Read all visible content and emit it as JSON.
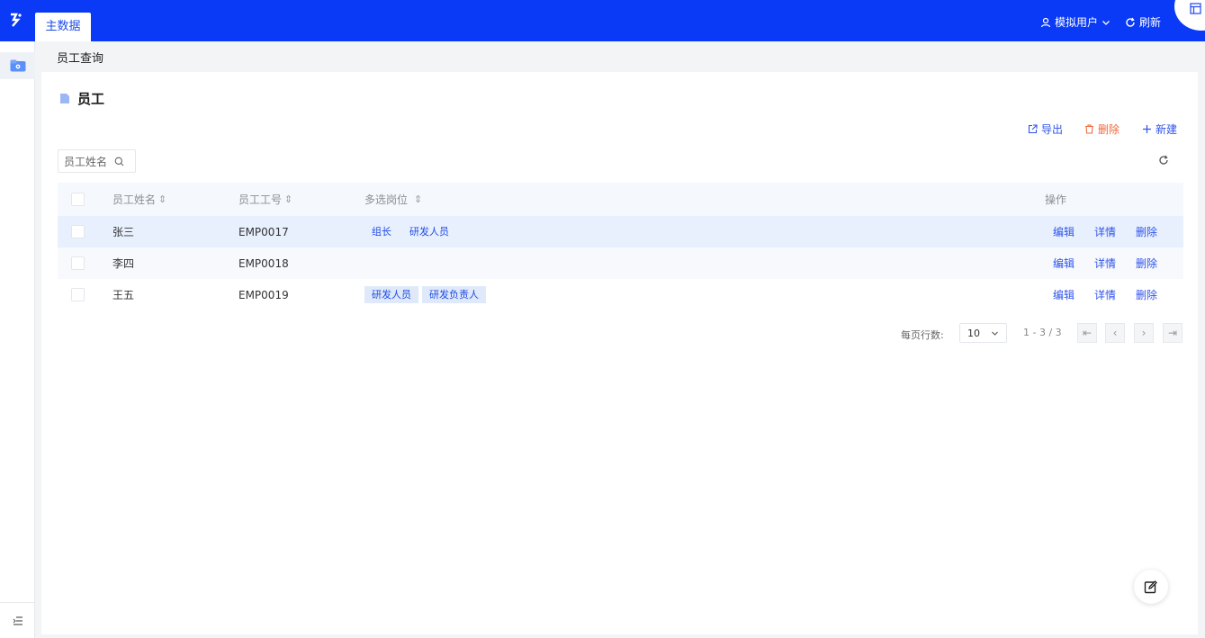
{
  "topbar": {
    "active_tab": "主数据",
    "user_label": "模拟用户",
    "refresh_label": "刷新"
  },
  "breadcrumb": "员工查询",
  "page": {
    "title": "员工"
  },
  "toolbar": {
    "export": "导出",
    "delete": "删除",
    "new": "新建"
  },
  "search": {
    "placeholder": "员工姓名"
  },
  "table": {
    "headers": {
      "name": "员工姓名",
      "no": "员工工号",
      "positions": "多选岗位",
      "ops": "操作"
    },
    "rows": [
      {
        "name": "张三",
        "no": "EMP0017",
        "positions": [
          "组长",
          "研发人员"
        ]
      },
      {
        "name": "李四",
        "no": "EMP0018",
        "positions": []
      },
      {
        "name": "王五",
        "no": "EMP0019",
        "positions": [
          "研发人员",
          "研发负责人"
        ]
      }
    ],
    "row_actions": {
      "edit": "编辑",
      "detail": "详情",
      "delete": "删除"
    }
  },
  "pagination": {
    "label": "每页行数:",
    "page_size": "10",
    "info": "1 - 3 / 3"
  },
  "colors": {
    "brand": "#0a3af5",
    "link": "#2f54eb",
    "danger": "#f0683b"
  }
}
